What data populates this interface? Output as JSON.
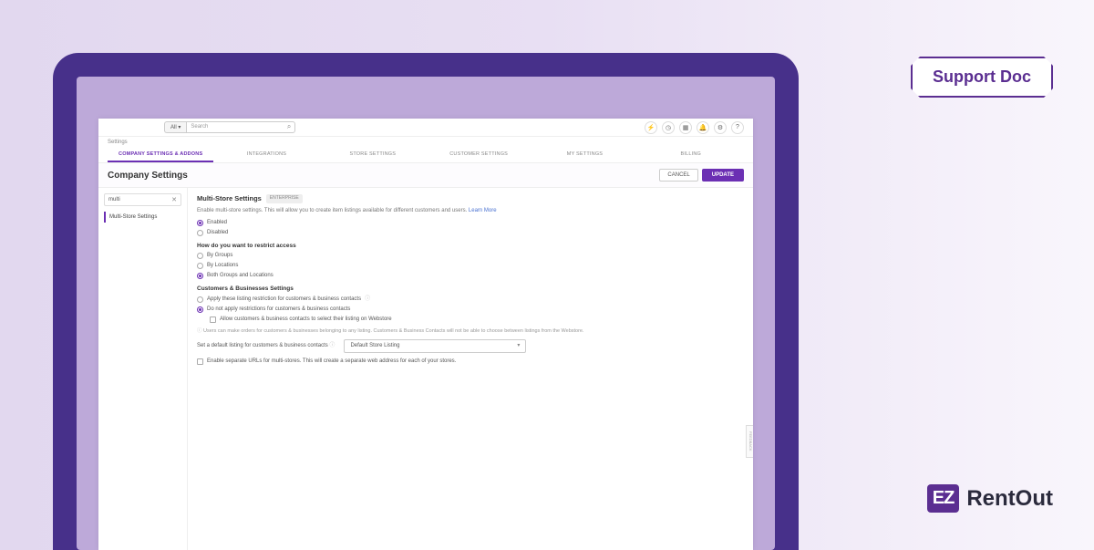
{
  "support_badge": "Support Doc",
  "brand": {
    "icon": "EZ",
    "text": "RentOut"
  },
  "topbar": {
    "scope": "All ▾",
    "search_placeholder": "Search",
    "icons": [
      "bolt-icon",
      "clock-icon",
      "calendar-icon",
      "bell-icon",
      "gear-icon",
      "help-icon"
    ],
    "glyphs": {
      "bolt-icon": "⚡",
      "clock-icon": "◷",
      "calendar-icon": "▦",
      "bell-icon": "🔔",
      "gear-icon": "⚙",
      "help-icon": "?"
    }
  },
  "settings_label": "Settings",
  "tabs": [
    "COMPANY SETTINGS & ADDONS",
    "INTEGRATIONS",
    "STORE SETTINGS",
    "CUSTOMER SETTINGS",
    "MY SETTINGS",
    "BILLING"
  ],
  "page": {
    "title": "Company Settings",
    "cancel": "CANCEL",
    "update": "UPDATE"
  },
  "sidebar": {
    "search_value": "multi",
    "item": "Multi-Store Settings"
  },
  "content": {
    "section_title": "Multi-Store Settings",
    "badge": "ENTERPRISE",
    "desc": "Enable multi-store settings. This will allow you to create item listings available for different customers and users.",
    "learn_more": "Learn More",
    "enable_options": {
      "enabled": "Enabled",
      "disabled": "Disabled"
    },
    "restrict_heading": "How do you want to restrict access",
    "restrict_options": {
      "groups": "By Groups",
      "locations": "By Locations",
      "both": "Both Groups and Locations"
    },
    "cb_heading": "Customers & Businesses Settings",
    "cb_options": {
      "apply": "Apply these listing restriction for customers & business contacts",
      "donot": "Do not apply restrictions for customers & business contacts"
    },
    "allow_webstore": "Allow customers & business contacts to select their listing on Webstore",
    "info_note": "Users can make orders for customers & businesses belonging to any listing. Customers & Business Contacts will not be able to choose between listings from the Webstore.",
    "default_label": "Set a default listing for customers & business contacts",
    "default_value": "Default Store Listing",
    "separate_urls": "Enable separate URLs for multi-stores. This will create a separate web address for each of your stores.",
    "feedback": "FEEDBACK"
  }
}
